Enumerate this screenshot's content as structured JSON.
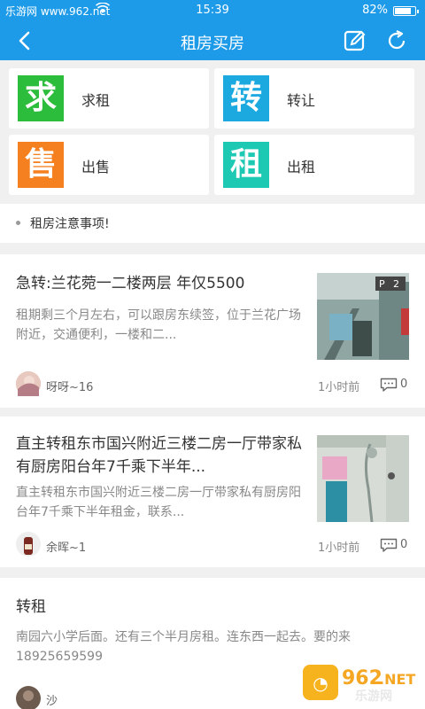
{
  "status_bar": {
    "carrier": "乐游网 www.962.net",
    "time": "15:39",
    "battery_pct": "82%",
    "battery_level": 0.82
  },
  "nav": {
    "title": "租房买房"
  },
  "grid": [
    {
      "glyph": "求",
      "label": "求租",
      "color": "#2dbd3c"
    },
    {
      "glyph": "转",
      "label": "转让",
      "color": "#1ba9e0"
    },
    {
      "glyph": "售",
      "label": "出售",
      "color": "#f5801f"
    },
    {
      "glyph": "租",
      "label": "出租",
      "color": "#1ec9b4"
    }
  ],
  "notice": {
    "text": "租房注意事项!"
  },
  "posts": [
    {
      "title": "急转:兰花菀一二楼两层 年仅5500",
      "desc": "租期剩三个月左右，可以跟房东续签，位于兰花广场附近，交通便利，一楼和二...",
      "author": "呀呀~16",
      "time": "1小时前",
      "comments": "0",
      "photo_badge": "2"
    },
    {
      "title": "直主转租东市国兴附近三楼二房一厅带家私 有厨房阳台年7千乘下半年...",
      "desc": "直主转租东市国兴附近三楼二房一厅带家私有厨房阳台年7千乘下半年租金，联系...",
      "author": "余晖~1",
      "time": "1小时前",
      "comments": "0"
    },
    {
      "title": "转租",
      "desc": "南园六小学后面。还有三个半月房租。连东西一起去。要的来18925659599",
      "author": "沙"
    }
  ],
  "watermark": {
    "brand": "962",
    "suffix": ".NET",
    "caption": "乐游网"
  }
}
